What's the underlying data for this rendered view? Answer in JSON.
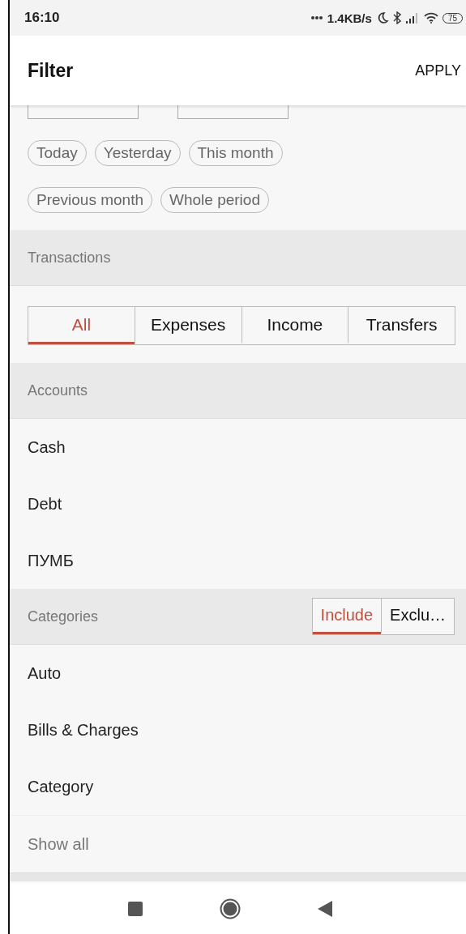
{
  "status_bar": {
    "time": "16:10",
    "network_speed": "1.4KB/s",
    "battery": "75"
  },
  "header": {
    "title": "Filter",
    "action": "APPLY"
  },
  "period_chips": [
    {
      "label": "Today"
    },
    {
      "label": "Yesterday"
    },
    {
      "label": "This month"
    },
    {
      "label": "Previous month"
    },
    {
      "label": "Whole period"
    }
  ],
  "transactions": {
    "title": "Transactions",
    "options": [
      {
        "label": "All",
        "selected": true
      },
      {
        "label": "Expenses",
        "selected": false
      },
      {
        "label": "Income",
        "selected": false
      },
      {
        "label": "Transfers",
        "selected": false
      }
    ]
  },
  "accounts": {
    "title": "Accounts",
    "items": [
      {
        "label": "Cash"
      },
      {
        "label": "Debt"
      },
      {
        "label": "ПУМБ"
      }
    ]
  },
  "categories": {
    "title": "Categories",
    "modes": [
      {
        "label": "Include",
        "selected": true
      },
      {
        "label": "Exclu…",
        "selected": false
      }
    ],
    "items": [
      {
        "label": "Auto"
      },
      {
        "label": "Bills & Charges"
      },
      {
        "label": "Category"
      }
    ],
    "show_all": "Show all"
  }
}
